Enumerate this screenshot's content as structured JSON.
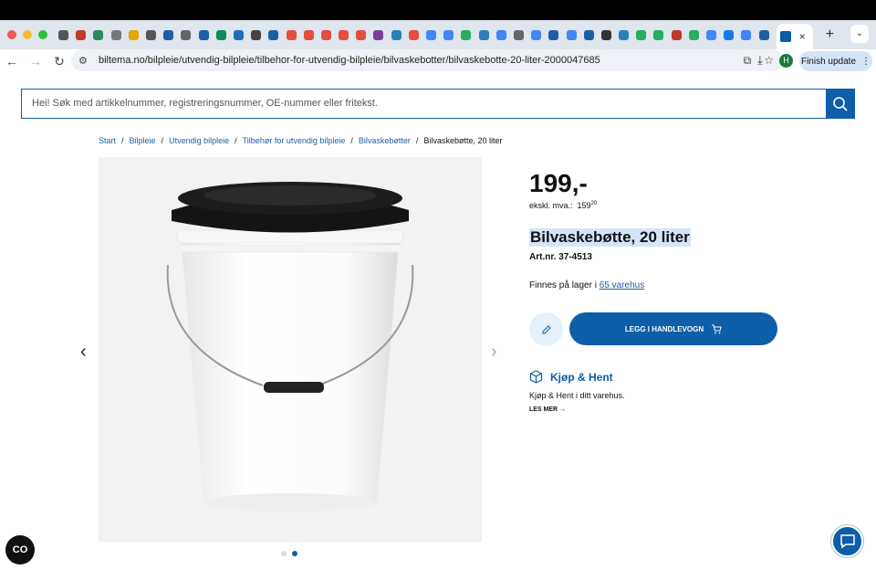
{
  "browser": {
    "url": "biltema.no/bilpleie/utvendig-bilpleie/tilbehor-for-utvendig-bilpleie/bilvaskebotter/bilvaskebotte-20-liter-2000047685",
    "finish_update": "Finish update",
    "avatar_letter": "H",
    "tab_close": "×",
    "new_tab": "+"
  },
  "search": {
    "placeholder": "Hei! Søk med artikkelnummer, registreringsnummer, OE-nummer eller fritekst."
  },
  "breadcrumb": {
    "items": [
      "Start",
      "Bilpleie",
      "Utvendig bilpleie",
      "Tilbehør for utvendig bilpleie",
      "Bilvaskebøtter"
    ],
    "current": "Bilvaskebøtte, 20 liter"
  },
  "product": {
    "price": "199,-",
    "vat_label": "ekskl. mva.:",
    "vat_price_main": "159",
    "vat_price_dec": "20",
    "title": "Bilvaskebøtte, 20 liter",
    "artnr": "Art.nr. 37-4513",
    "stock_prefix": "Finnes på lager i",
    "stock_link": "65 varehus",
    "cart_label": "LEGG I HANDLEVOGN"
  },
  "kjop_hent": {
    "title": "Kjøp & Hent",
    "text": "Kjøp & Hent i ditt varehus.",
    "more": "LES MER →"
  },
  "gallery": {
    "active_index": 1,
    "count": 2
  },
  "fab_left": "CO",
  "colors": {
    "brand_blue": "#0e5ea8",
    "highlight": "#d6e4f8"
  }
}
